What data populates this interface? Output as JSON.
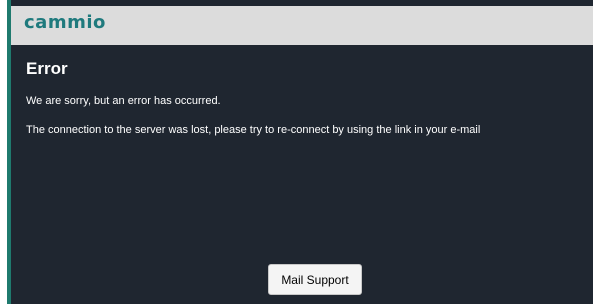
{
  "header": {
    "logo_text": "cammio"
  },
  "error": {
    "title": "Error",
    "message_1": "We are sorry, but an error has occurred.",
    "message_2": "The connection to the server was lost, please try to re-connect by using the link in your e-mail"
  },
  "actions": {
    "mail_support_label": "Mail Support"
  },
  "colors": {
    "accent": "#1f7a6e",
    "header_bg": "#dcdcdc",
    "content_bg": "#1f2630",
    "text": "#ffffff"
  }
}
